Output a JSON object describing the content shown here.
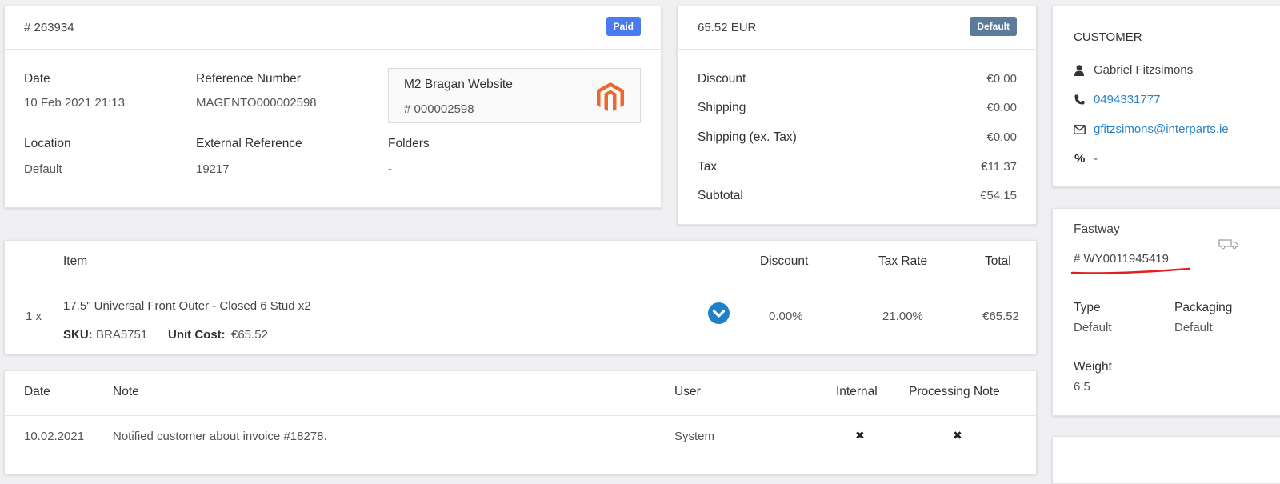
{
  "order": {
    "number": "# 263934",
    "status_badge": "Paid",
    "date_label": "Date",
    "date_value": "10 Feb 2021 21:13",
    "ref_label": "Reference Number",
    "ref_value": "MAGENTO000002598",
    "location_label": "Location",
    "location_value": "Default",
    "ext_ref_label": "External Reference",
    "ext_ref_value": "19217",
    "folders_label": "Folders",
    "folders_value": "-",
    "source": {
      "name": "M2 Bragan Website",
      "number": "# 000002598",
      "icon": "magento-icon"
    }
  },
  "totals": {
    "amount": "65.52 EUR",
    "badge": "Default",
    "rows": [
      {
        "label": "Discount",
        "value": "€0.00"
      },
      {
        "label": "Shipping",
        "value": "€0.00"
      },
      {
        "label": "Shipping (ex. Tax)",
        "value": "€0.00"
      },
      {
        "label": "Tax",
        "value": "€11.37"
      },
      {
        "label": "Subtotal",
        "value": "€54.15"
      }
    ]
  },
  "items": {
    "headers": {
      "item": "Item",
      "discount": "Discount",
      "tax_rate": "Tax Rate",
      "total": "Total"
    },
    "rows": [
      {
        "qty": "1 x",
        "name": "17.5\" Universal Front Outer - Closed 6 Stud x2",
        "sku_label": "SKU:",
        "sku": "BRA5751",
        "unit_cost_label": "Unit Cost:",
        "unit_cost": "€65.52",
        "discount": "0.00%",
        "tax_rate": "21.00%",
        "total": "€65.52"
      }
    ]
  },
  "notes": {
    "headers": {
      "date": "Date",
      "note": "Note",
      "user": "User",
      "internal": "Internal",
      "processing": "Processing Note"
    },
    "rows": [
      {
        "date": "10.02.2021",
        "note": "Notified customer about invoice #18278.",
        "user": "System",
        "internal": "✖",
        "processing": "✖"
      }
    ]
  },
  "customer": {
    "title": "CUSTOMER",
    "name": "Gabriel Fitzsimons",
    "phone": "0494331777",
    "email": "gfitzsimons@interparts.ie",
    "discount": "-"
  },
  "shipping": {
    "carrier": "Fastway",
    "tracking": "# WY0011945419",
    "type_label": "Type",
    "type_value": "Default",
    "packaging_label": "Packaging",
    "packaging_value": "Default",
    "weight_label": "Weight",
    "weight_value": "6.5"
  },
  "colors": {
    "paid_badge": "#4a7bf0",
    "default_badge": "#5c7a99",
    "link": "#2a82c9",
    "magento": "#ee672f",
    "underline": "#e02020"
  }
}
